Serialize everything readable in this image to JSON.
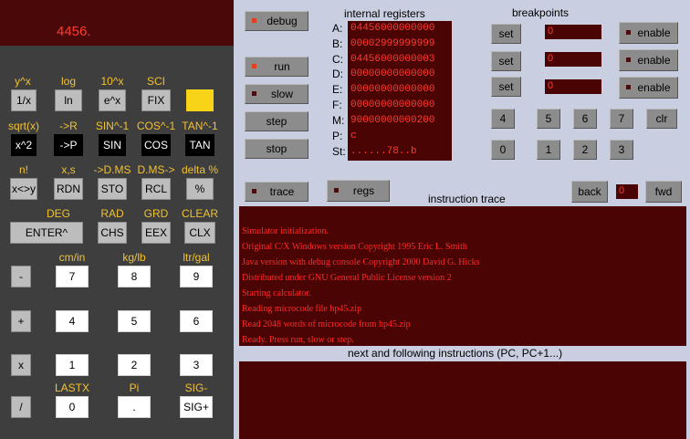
{
  "calculator": {
    "display": "4456.",
    "rows": [
      {
        "labels": [
          "y^x",
          "log",
          "10^x",
          "SCI",
          ""
        ],
        "keys": [
          "1/x",
          "ln",
          "e^x",
          "FIX",
          ""
        ]
      },
      {
        "labels": [
          "sqrt(x)",
          "->R",
          "SIN^-1",
          "COS^-1",
          "TAN^-1"
        ],
        "keys": [
          "x^2",
          "->P",
          "SIN",
          "COS",
          "TAN"
        ]
      },
      {
        "labels": [
          "n!",
          "x,s",
          "->D.MS",
          "D.MS->",
          "delta %"
        ],
        "keys": [
          "x<>y",
          "RDN",
          "STO",
          "RCL",
          "%"
        ]
      }
    ],
    "row4_labels": [
      "DEG",
      "RAD",
      "GRD",
      "CLEAR"
    ],
    "row4_keys": [
      "ENTER^",
      "CHS",
      "EEX",
      "CLX"
    ],
    "num_labels_top": [
      "cm/in",
      "kg/lb",
      "ltr/gal"
    ],
    "num_row1": [
      "-",
      "7",
      "8",
      "9"
    ],
    "num_row2": [
      "+",
      "4",
      "5",
      "6"
    ],
    "num_row3": [
      "x",
      "1",
      "2",
      "3"
    ],
    "num_labels_bottom": [
      "LASTX",
      "Pi",
      "SIG-"
    ],
    "num_row4": [
      "/",
      "0",
      ".",
      "SIG+"
    ]
  },
  "console": {
    "debug_label": "debug",
    "run_label": "run",
    "slow_label": "slow",
    "step_label": "step",
    "stop_label": "stop",
    "registers_title": "internal registers",
    "registers": [
      {
        "name": "A:",
        "value": "04456000000000"
      },
      {
        "name": "B:",
        "value": "00002999999999"
      },
      {
        "name": "C:",
        "value": "04456000000003"
      },
      {
        "name": "D:",
        "value": "00000000000000"
      },
      {
        "name": "E:",
        "value": "00000000000000"
      },
      {
        "name": "F:",
        "value": "00000000000000"
      },
      {
        "name": "M:",
        "value": "90000000000200"
      },
      {
        "name": "P:",
        "value": "c"
      },
      {
        "name": "St:",
        "value": "......78..b"
      }
    ],
    "breakpoints_title": "breakpoints",
    "breakpoints": [
      {
        "set": "set",
        "value": "0",
        "enable": "enable"
      },
      {
        "set": "set",
        "value": "0",
        "enable": "enable"
      },
      {
        "set": "set",
        "value": "0",
        "enable": "enable"
      }
    ],
    "digit_row1": [
      "4",
      "5",
      "6",
      "7",
      "clr"
    ],
    "digit_row2": [
      "0",
      "1",
      "2",
      "3"
    ],
    "trace_label": "trace",
    "regs_label": "regs",
    "back_label": "back",
    "nav_value": "0",
    "fwd_label": "fwd",
    "trace_title": "instruction trace",
    "trace_lines": [
      "Simulator initialization.",
      "Original C/X Windows version Copyright 1995 Eric L. Smith",
      "Java version with debug console Copyright 2000 David G. Hicks",
      "Distributed under GNU General Public License version 2",
      "Starting calculator.",
      "Reading microcode file hp45.zip",
      "Read 2048 words of microcode from hp45.zip",
      "Ready.  Press run, slow or step."
    ],
    "next_title": "next and following instructions (PC, PC+1...)"
  },
  "colors": {
    "led_on": "#e04020",
    "led_off": "#4a0e0e",
    "display_text": "#ff3b2f",
    "dark_panel": "#4a0404"
  }
}
